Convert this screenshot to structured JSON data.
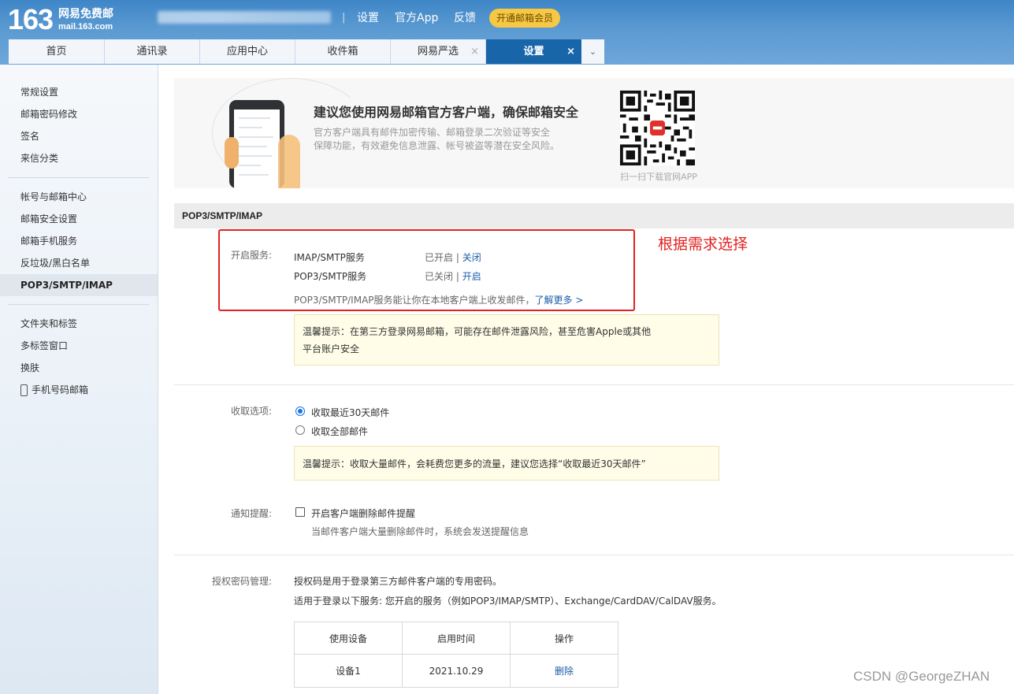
{
  "header": {
    "logo_number": "163",
    "logo_name": "网易免费邮",
    "logo_domain": "mail.163.com",
    "separator": "|",
    "links": [
      "设置",
      "官方App",
      "反馈"
    ],
    "vip_button": "开通邮箱会员"
  },
  "tabs": [
    {
      "label": "首页",
      "closable": false,
      "active": false
    },
    {
      "label": "通讯录",
      "closable": false,
      "active": false
    },
    {
      "label": "应用中心",
      "closable": false,
      "active": false
    },
    {
      "label": "收件箱",
      "closable": false,
      "active": false
    },
    {
      "label": "网易严选",
      "closable": true,
      "active": false
    },
    {
      "label": "设置",
      "closable": true,
      "active": true
    }
  ],
  "tab_close_glyph": "×",
  "tab_more_glyph": "⌄",
  "sidebar": {
    "group1": [
      "常规设置",
      "邮箱密码修改",
      "签名",
      "来信分类"
    ],
    "group2": [
      "帐号与邮箱中心",
      "邮箱安全设置",
      "邮箱手机服务",
      "反垃圾/黑白名单",
      "POP3/SMTP/IMAP"
    ],
    "group3": [
      "文件夹和标签",
      "多标签窗口",
      "换肤",
      "手机号码邮箱"
    ],
    "active": "POP3/SMTP/IMAP"
  },
  "banner": {
    "title": "建议您使用网易邮箱官方客户端，确保邮箱安全",
    "desc_line1": "官方客户端具有邮件加密传输、邮箱登录二次验证等安全",
    "desc_line2": "保障功能，有效避免信息泄露、帐号被盗等潜在安全风险。",
    "qr_caption": "扫一扫下载官网APP"
  },
  "section_title": "POP3/SMTP/IMAP",
  "services": {
    "label": "开启服务:",
    "rows": [
      {
        "name": "IMAP/SMTP服务",
        "status": "已开启",
        "sep": " | ",
        "action": "关闭"
      },
      {
        "name": "POP3/SMTP服务",
        "status": "已关闭",
        "sep": " | ",
        "action": "开启"
      }
    ],
    "note": "POP3/SMTP/IMAP服务能让你在本地客户端上收发邮件，",
    "learn_more": "了解更多 >",
    "tip_line1": "温馨提示：在第三方登录网易邮箱，可能存在邮件泄露风险，甚至危害Apple或其他",
    "tip_line2": "平台账户安全"
  },
  "annotation": "根据需求选择",
  "receive": {
    "label": "收取选项:",
    "options": [
      "收取最近30天邮件",
      "收取全部邮件"
    ],
    "selected_index": 0,
    "tip": "温馨提示：收取大量邮件，会耗费您更多的流量，建议您选择“收取最近30天邮件”"
  },
  "notify": {
    "label": "通知提醒:",
    "checkbox_label": "开启客户端删除邮件提醒",
    "checked": false,
    "desc": "当邮件客户端大量删除邮件时，系统会发送提醒信息"
  },
  "auth": {
    "label": "授权密码管理:",
    "desc1": "授权码是用于登录第三方邮件客户端的专用密码。",
    "desc2": "适用于登录以下服务: 您开启的服务（例如POP3/IMAP/SMTP）、Exchange/CardDAV/CalDAV服务。",
    "table_headers": [
      "使用设备",
      "启用时间",
      "操作"
    ],
    "table_rows": [
      {
        "device": "设备1",
        "time": "2021.10.29",
        "action": "删除"
      }
    ]
  },
  "watermark": "CSDN @GeorgeZHAN",
  "colors": {
    "header_blue": "#4a8fcd",
    "active_tab": "#1965a9",
    "vip_yellow": "#f7c844",
    "link_blue": "#1b5da8",
    "annotation_red": "#e2221f",
    "radio_blue": "#1a73e8"
  }
}
